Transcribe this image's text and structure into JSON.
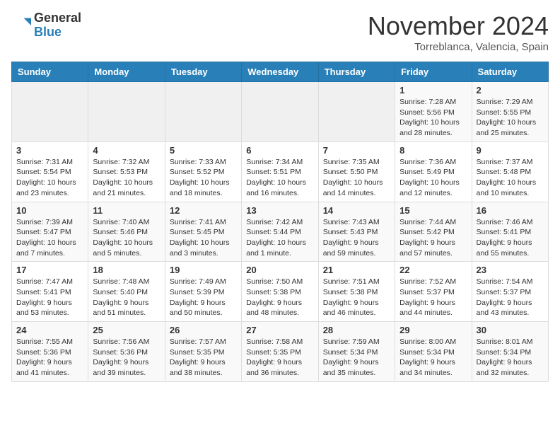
{
  "header": {
    "logo_general": "General",
    "logo_blue": "Blue",
    "month_title": "November 2024",
    "subtitle": "Torreblanca, Valencia, Spain"
  },
  "weekdays": [
    "Sunday",
    "Monday",
    "Tuesday",
    "Wednesday",
    "Thursday",
    "Friday",
    "Saturday"
  ],
  "weeks": [
    [
      {
        "day": "",
        "info": ""
      },
      {
        "day": "",
        "info": ""
      },
      {
        "day": "",
        "info": ""
      },
      {
        "day": "",
        "info": ""
      },
      {
        "day": "",
        "info": ""
      },
      {
        "day": "1",
        "info": "Sunrise: 7:28 AM\nSunset: 5:56 PM\nDaylight: 10 hours and 28 minutes."
      },
      {
        "day": "2",
        "info": "Sunrise: 7:29 AM\nSunset: 5:55 PM\nDaylight: 10 hours and 25 minutes."
      }
    ],
    [
      {
        "day": "3",
        "info": "Sunrise: 7:31 AM\nSunset: 5:54 PM\nDaylight: 10 hours and 23 minutes."
      },
      {
        "day": "4",
        "info": "Sunrise: 7:32 AM\nSunset: 5:53 PM\nDaylight: 10 hours and 21 minutes."
      },
      {
        "day": "5",
        "info": "Sunrise: 7:33 AM\nSunset: 5:52 PM\nDaylight: 10 hours and 18 minutes."
      },
      {
        "day": "6",
        "info": "Sunrise: 7:34 AM\nSunset: 5:51 PM\nDaylight: 10 hours and 16 minutes."
      },
      {
        "day": "7",
        "info": "Sunrise: 7:35 AM\nSunset: 5:50 PM\nDaylight: 10 hours and 14 minutes."
      },
      {
        "day": "8",
        "info": "Sunrise: 7:36 AM\nSunset: 5:49 PM\nDaylight: 10 hours and 12 minutes."
      },
      {
        "day": "9",
        "info": "Sunrise: 7:37 AM\nSunset: 5:48 PM\nDaylight: 10 hours and 10 minutes."
      }
    ],
    [
      {
        "day": "10",
        "info": "Sunrise: 7:39 AM\nSunset: 5:47 PM\nDaylight: 10 hours and 7 minutes."
      },
      {
        "day": "11",
        "info": "Sunrise: 7:40 AM\nSunset: 5:46 PM\nDaylight: 10 hours and 5 minutes."
      },
      {
        "day": "12",
        "info": "Sunrise: 7:41 AM\nSunset: 5:45 PM\nDaylight: 10 hours and 3 minutes."
      },
      {
        "day": "13",
        "info": "Sunrise: 7:42 AM\nSunset: 5:44 PM\nDaylight: 10 hours and 1 minute."
      },
      {
        "day": "14",
        "info": "Sunrise: 7:43 AM\nSunset: 5:43 PM\nDaylight: 9 hours and 59 minutes."
      },
      {
        "day": "15",
        "info": "Sunrise: 7:44 AM\nSunset: 5:42 PM\nDaylight: 9 hours and 57 minutes."
      },
      {
        "day": "16",
        "info": "Sunrise: 7:46 AM\nSunset: 5:41 PM\nDaylight: 9 hours and 55 minutes."
      }
    ],
    [
      {
        "day": "17",
        "info": "Sunrise: 7:47 AM\nSunset: 5:41 PM\nDaylight: 9 hours and 53 minutes."
      },
      {
        "day": "18",
        "info": "Sunrise: 7:48 AM\nSunset: 5:40 PM\nDaylight: 9 hours and 51 minutes."
      },
      {
        "day": "19",
        "info": "Sunrise: 7:49 AM\nSunset: 5:39 PM\nDaylight: 9 hours and 50 minutes."
      },
      {
        "day": "20",
        "info": "Sunrise: 7:50 AM\nSunset: 5:38 PM\nDaylight: 9 hours and 48 minutes."
      },
      {
        "day": "21",
        "info": "Sunrise: 7:51 AM\nSunset: 5:38 PM\nDaylight: 9 hours and 46 minutes."
      },
      {
        "day": "22",
        "info": "Sunrise: 7:52 AM\nSunset: 5:37 PM\nDaylight: 9 hours and 44 minutes."
      },
      {
        "day": "23",
        "info": "Sunrise: 7:54 AM\nSunset: 5:37 PM\nDaylight: 9 hours and 43 minutes."
      }
    ],
    [
      {
        "day": "24",
        "info": "Sunrise: 7:55 AM\nSunset: 5:36 PM\nDaylight: 9 hours and 41 minutes."
      },
      {
        "day": "25",
        "info": "Sunrise: 7:56 AM\nSunset: 5:36 PM\nDaylight: 9 hours and 39 minutes."
      },
      {
        "day": "26",
        "info": "Sunrise: 7:57 AM\nSunset: 5:35 PM\nDaylight: 9 hours and 38 minutes."
      },
      {
        "day": "27",
        "info": "Sunrise: 7:58 AM\nSunset: 5:35 PM\nDaylight: 9 hours and 36 minutes."
      },
      {
        "day": "28",
        "info": "Sunrise: 7:59 AM\nSunset: 5:34 PM\nDaylight: 9 hours and 35 minutes."
      },
      {
        "day": "29",
        "info": "Sunrise: 8:00 AM\nSunset: 5:34 PM\nDaylight: 9 hours and 34 minutes."
      },
      {
        "day": "30",
        "info": "Sunrise: 8:01 AM\nSunset: 5:34 PM\nDaylight: 9 hours and 32 minutes."
      }
    ]
  ]
}
